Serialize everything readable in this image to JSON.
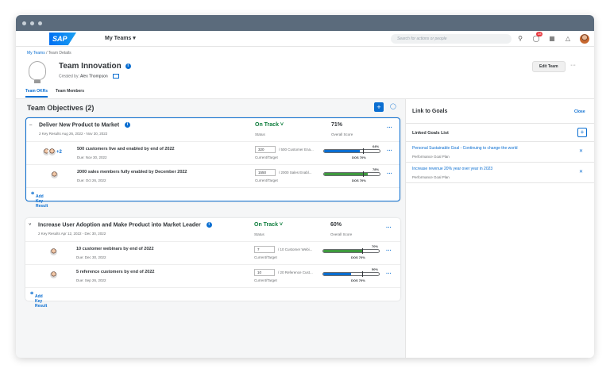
{
  "shell": {
    "logo": "SAP",
    "app_menu": "My Teams ▾",
    "search_placeholder": "Search for actions or people",
    "notifications_count": "28"
  },
  "header": {
    "breadcrumb_root": "My Teams",
    "breadcrumb_sep": " / ",
    "breadcrumb_current": "Team Details",
    "title": "Team Innovation",
    "created_label": "Created by:",
    "created_by": "Alex Thompson",
    "edit_button": "Edit Team",
    "tabs": [
      "Team OKRs",
      "Team Members"
    ]
  },
  "objectives": {
    "title": "Team Objectives (2)",
    "items": [
      {
        "name": "Deliver New Product to Market",
        "sub": "2 Key Results  Aug 26, 2022 - Nov 30, 2022",
        "status": "On Track ˅",
        "status_label": "Status",
        "score": "71%",
        "score_label": "Overall Score",
        "key_results": [
          {
            "name": "500 customers live and enabled by end of 2022",
            "due": "Due: Nov 30, 2022",
            "current": "320",
            "target": "/ 500 Customer Ena...",
            "ct_label": "Current/Target",
            "pct": "64%",
            "dos": "DOS 70%",
            "extra": "+2",
            "progress": 0.64,
            "dos_value": 0.7,
            "fill": "#0a6ed1"
          },
          {
            "name": "2000 sales members fully enabled by December 2022",
            "due": "Due: Oct 26, 2022",
            "current": "1550",
            "target": "/ 2000 Sales Enabl...",
            "ct_label": "Current/Target",
            "pct": "78%",
            "dos": "DOS 70%",
            "progress": 0.78,
            "dos_value": 0.7,
            "fill": "#3e9a3e"
          }
        ],
        "add_label": "Add Key Result"
      },
      {
        "name": "Increase User Adoption and Make Product into Market Leader",
        "sub": "2 Key Results  Apr 12, 2022 - Dec 30, 2022",
        "status": "On Track ˅",
        "status_label": "Status",
        "score": "60%",
        "score_label": "Overall Score",
        "key_results": [
          {
            "name": "10 customer webinars by end of 2022",
            "due": "Due: Dec 30, 2022",
            "current": "7",
            "target": "/ 10 Customer Webi...",
            "ct_label": "Current/Target",
            "pct": "70%",
            "dos": "DOS 70%",
            "progress": 0.7,
            "dos_value": 0.7,
            "fill": "#3e9a3e"
          },
          {
            "name": "5 reference customers by end of 2022",
            "due": "Due: Sep 26, 2022",
            "current": "10",
            "target": "/ 20 Reference Cust...",
            "ct_label": "Current/Target",
            "pct": "50%",
            "dos": "DOS 70%",
            "progress": 0.5,
            "dos_value": 0.7,
            "fill": "#0a6ed1"
          }
        ],
        "add_label": "Add Key Result"
      }
    ]
  },
  "goals_panel": {
    "title": "Link to Goals",
    "close": "Close",
    "list_title": "Linked Goals List",
    "goals": [
      {
        "name": "Personal Sustainable Goal - Continuing to change the world",
        "plan": "Performance Goal Plan"
      },
      {
        "name": "Increase revenue 20% year over year in 2023",
        "plan": "Performance Goal Plan"
      }
    ]
  }
}
